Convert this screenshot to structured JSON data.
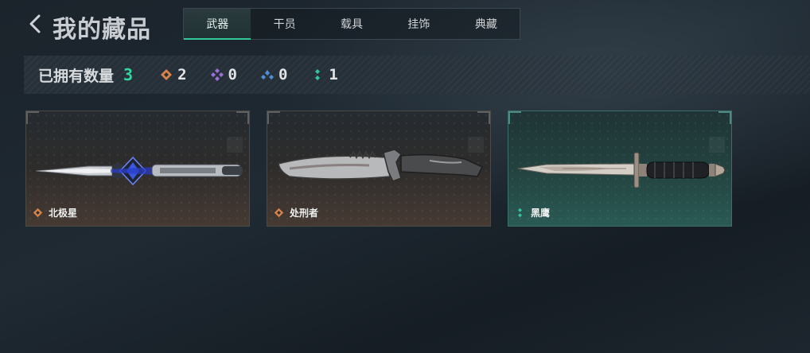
{
  "header": {
    "title": "我的藏品"
  },
  "tabs": [
    {
      "label": "武器",
      "active": true
    },
    {
      "label": "干员",
      "active": false
    },
    {
      "label": "载具",
      "active": false
    },
    {
      "label": "挂饰",
      "active": false
    },
    {
      "label": "典藏",
      "active": false
    }
  ],
  "summary": {
    "owned_label": "已拥有数量",
    "owned_count": "3",
    "rarities": [
      {
        "icon": "orange-diamond-icon",
        "color": "#d9824a",
        "count": "2"
      },
      {
        "icon": "purple-diamond-icon",
        "color": "#9b6fd6",
        "count": "0"
      },
      {
        "icon": "blue-diamond-icon",
        "color": "#4f8fd8",
        "count": "0"
      },
      {
        "icon": "green-dots-icon",
        "color": "#33c79b",
        "count": "1"
      }
    ]
  },
  "items": [
    {
      "name": "北极星",
      "rarity_icon": "orange-diamond-icon",
      "rarity_color": "#d9824a",
      "weapon": "dagger"
    },
    {
      "name": "处刑者",
      "rarity_icon": "orange-diamond-icon",
      "rarity_color": "#d9824a",
      "weapon": "serrated-knife"
    },
    {
      "name": "黑鹰",
      "rarity_icon": "green-dots-icon",
      "rarity_color": "#33c79b",
      "weapon": "combat-knife"
    }
  ],
  "colors": {
    "accent": "#31c99a",
    "owned_count": "#33d69f"
  }
}
